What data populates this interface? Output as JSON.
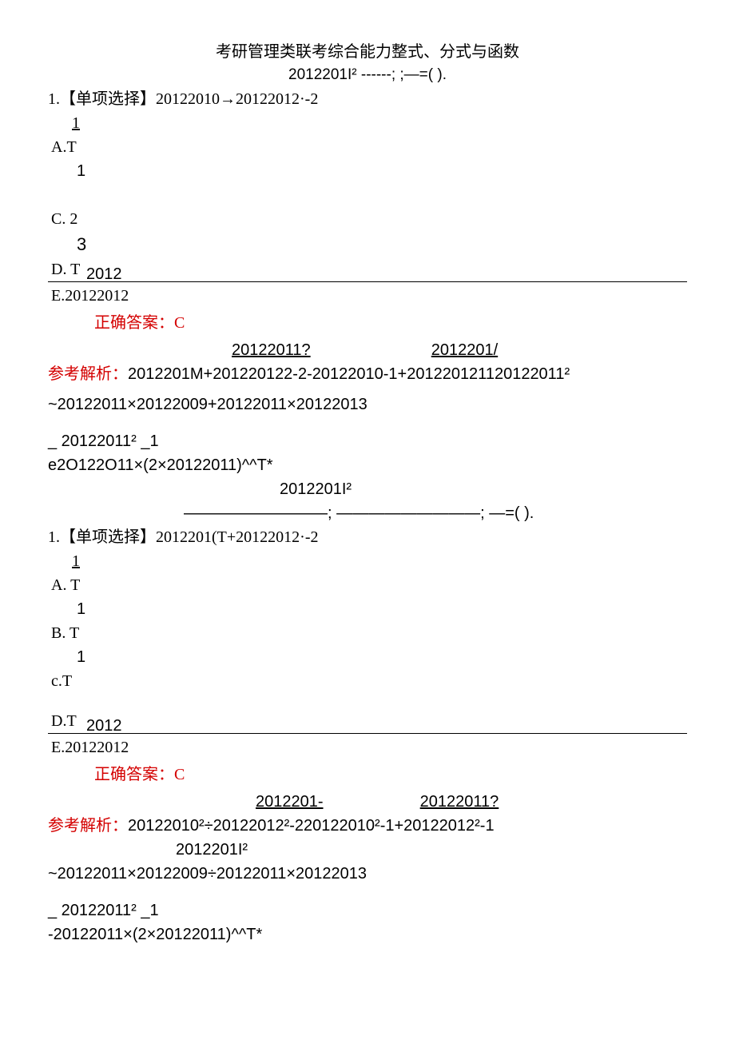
{
  "title": "考研管理类联考综合能力整式、分式与函数",
  "subtitleLine": "2012201I² ------;                ;—=( ).",
  "block1": {
    "stem": "1.【单项选择】20122010→20122012·-2",
    "optA_frac": "1",
    "optA": "A.T",
    "optA_below": "1",
    "optC": "C.  2",
    "optC_below": "3",
    "optD": "D.  T",
    "dividerLabel": "2012",
    "optE": "E.20122012",
    "answer": "正确答案：C",
    "analysisRow1_left": "20122011?",
    "analysisRow1_right": "2012201/",
    "analysisLine": "参考解析：2012201M+201220122-2-20122010-1+201220121120122011²",
    "analysisLine2": "~20122011×20122009+20122011×20122013",
    "analysisLine3_left": "_        20122011²           _1",
    "analysisLine3": "e2O122O11×(2×20122011)^^T*",
    "subtitle2_a": "2012201I²",
    "subtitle2_b": "—————————; —————————; —=(           )."
  },
  "block2": {
    "stem": "1.【单项选择】2012201(T+20122012·-2",
    "optA_frac": "1",
    "optA": "A.  T",
    "optA_below": "1",
    "optB": "B.  T",
    "optB_below": "1",
    "optC": "c.T",
    "optD": "D.T",
    "dividerLabel": "2012",
    "optE": "E.20122012",
    "answer": "正确答案：C",
    "analysisRow1_left": "2012201-",
    "analysisRow1_right": "20122011?",
    "analysisLine": "参考解析：20122010²÷20122012²-220122010²-1+20122012²-1",
    "analysisIndent": "2012201I²",
    "analysisLine2": "~20122011×20122009÷20122011×20122013",
    "analysisLine3_left": "_        20122011²            _1",
    "analysisLine3": "-20122011×(2×20122011)^^T*"
  }
}
